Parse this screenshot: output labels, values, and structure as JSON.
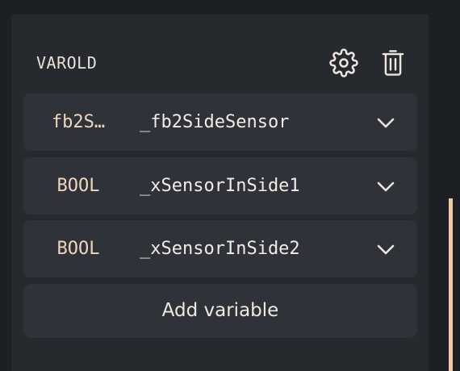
{
  "panel": {
    "title": "VAROLD",
    "settings_icon": "gear-icon",
    "delete_icon": "trash-icon"
  },
  "variables": [
    {
      "type": "fb2S…",
      "name": "_fb2SideSensor",
      "expand_icon": "chevron-down-icon"
    },
    {
      "type": "BOOL",
      "name": "_xSensorInSide1",
      "expand_icon": "chevron-down-icon"
    },
    {
      "type": "BOOL",
      "name": "_xSensorInSide2",
      "expand_icon": "chevron-down-icon"
    }
  ],
  "add_button": {
    "label": "Add variable"
  },
  "colors": {
    "background": "#1c1f24",
    "panel": "#26292e",
    "row": "#2f3238",
    "type_text": "#f1d6bd",
    "name_text": "#f1ece4",
    "accent_scrollbar": "#f3c9a0"
  }
}
